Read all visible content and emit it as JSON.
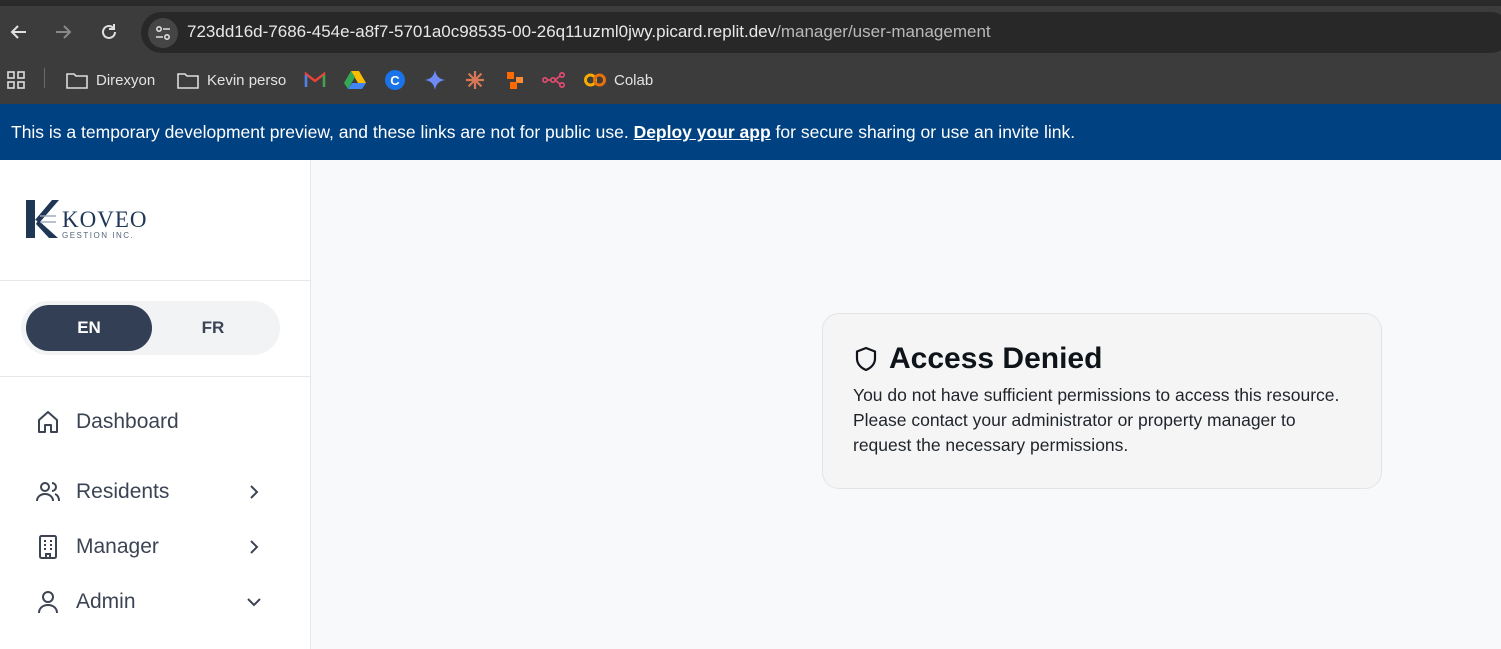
{
  "browser": {
    "url_main": "723dd16d-7686-454e-a8f7-5701a0c98535-00-26q11uzml0jwy.picard.replit.dev",
    "url_path": "/manager/user-management",
    "icons": [
      "back-icon",
      "forward-icon",
      "reload-icon",
      "site-info-icon"
    ]
  },
  "bookmarks": {
    "items": [
      {
        "label": "Direxyon",
        "icon": "folder-icon"
      },
      {
        "label": "Kevin perso",
        "icon": "folder-icon"
      },
      {
        "label": "",
        "icon": "gmail-icon"
      },
      {
        "label": "",
        "icon": "drive-icon"
      },
      {
        "label": "",
        "icon": "c-app-icon"
      },
      {
        "label": "",
        "icon": "gemini-icon"
      },
      {
        "label": "",
        "icon": "claude-icon"
      },
      {
        "label": "",
        "icon": "zapier-icon"
      },
      {
        "label": "",
        "icon": "n8n-icon"
      },
      {
        "label": "Colab",
        "icon": "colab-icon"
      }
    ]
  },
  "banner": {
    "prefix": "This is a temporary development preview, and these links are not for public use.",
    "link": "Deploy your app",
    "suffix": "for secure sharing or use an invite link."
  },
  "sidebar": {
    "logo": {
      "name": "KOVEO",
      "sub": "GESTION INC."
    },
    "language": {
      "active": "EN",
      "inactive": "FR"
    },
    "nav": [
      {
        "label": "Dashboard",
        "icon": "home-icon"
      },
      {
        "label": "Residents",
        "icon": "users-icon"
      },
      {
        "label": "Manager",
        "icon": "building-icon"
      },
      {
        "label": "Admin",
        "icon": "user-icon"
      }
    ]
  },
  "main": {
    "title": "Access Denied",
    "message": "You do not have sufficient permissions to access this resource. Please contact your administrator or property manager to request the necessary permissions."
  },
  "colors": {
    "banner": "#004181",
    "lang_active": "#333f55",
    "text": "#3c4454"
  }
}
